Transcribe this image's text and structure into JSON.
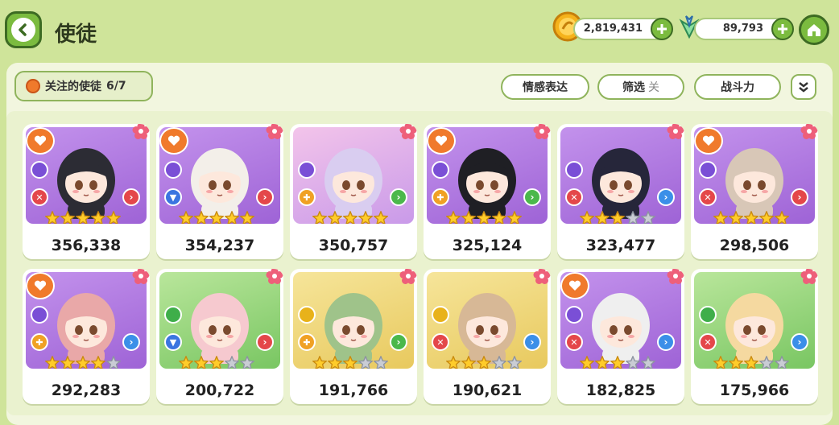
{
  "header": {
    "title": "使徒"
  },
  "currencies": {
    "gold": "2,819,431",
    "gems": "89,793"
  },
  "toolbar": {
    "follow_label": "关注的使徒",
    "follow_count": "6/7",
    "emotion_label": "情感表达",
    "filter_label": "筛选",
    "filter_state": "关",
    "power_label": "战斗力"
  },
  "colors": {
    "purple_bg": "#b47ee0",
    "green_bg": "#9fd97a",
    "yellow_bg": "#f1dc7a",
    "accent_green": "#7bbb3f",
    "heart_orange": "#f07a2c",
    "role_red": "#e4474a",
    "arrow_blue": "#3b8fe8",
    "arrow_green": "#4bb84b"
  },
  "cards": [
    {
      "power": "356,338",
      "stars": 5,
      "bg": "purple",
      "favorite": true,
      "role": "red",
      "arrow": "red",
      "hair": "#2c2c34"
    },
    {
      "power": "354,237",
      "stars": 5,
      "bg": "purple",
      "favorite": true,
      "role": "blue",
      "arrow": "red",
      "hair": "#f3efe9"
    },
    {
      "power": "350,757",
      "stars": 5,
      "bg": "pink",
      "favorite": false,
      "role": "orange",
      "arrow": "green",
      "hair": "#d9cdf0"
    },
    {
      "power": "325,124",
      "stars": 5,
      "bg": "purple",
      "favorite": true,
      "role": "orange",
      "arrow": "green",
      "hair": "#1f1f24"
    },
    {
      "power": "323,477",
      "stars": 3,
      "bg": "purple",
      "favorite": false,
      "role": "red",
      "arrow": "blue",
      "hair": "#26263a"
    },
    {
      "power": "298,506",
      "stars": 5,
      "bg": "purple",
      "favorite": true,
      "role": "red",
      "arrow": "red",
      "hair": "#d8c7b7"
    },
    {
      "power": "292,283",
      "stars": 4,
      "bg": "purple",
      "favorite": true,
      "role": "orange",
      "arrow": "blue",
      "hair": "#e9a8a8"
    },
    {
      "power": "200,722",
      "stars": 3,
      "bg": "green",
      "favorite": false,
      "role": "blue",
      "arrow": "red",
      "hair": "#f6c9cf"
    },
    {
      "power": "191,766",
      "stars": 3,
      "bg": "yellow",
      "favorite": false,
      "role": "orange",
      "arrow": "green",
      "hair": "#9fc38a"
    },
    {
      "power": "190,621",
      "stars": 3,
      "bg": "yellow",
      "favorite": false,
      "role": "red",
      "arrow": "blue",
      "hair": "#d7b896"
    },
    {
      "power": "182,825",
      "stars": 3,
      "bg": "purple",
      "favorite": true,
      "role": "red",
      "arrow": "blue",
      "hair": "#efefef"
    },
    {
      "power": "175,966",
      "stars": 3,
      "bg": "green",
      "favorite": false,
      "role": "red",
      "arrow": "blue",
      "hair": "#f5d9a0"
    }
  ]
}
